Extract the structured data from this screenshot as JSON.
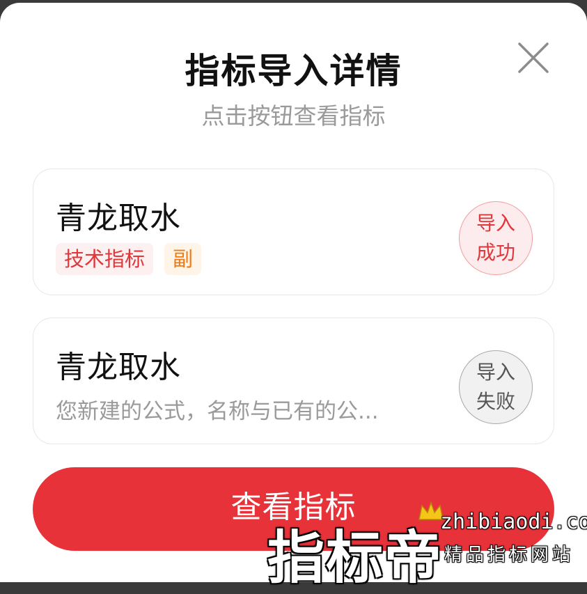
{
  "dialog": {
    "title": "指标导入详情",
    "subtitle": "点击按钮查看指标",
    "close_icon": "close-icon"
  },
  "results": [
    {
      "name": "青龙取水",
      "tags": [
        "技术指标",
        "副"
      ],
      "status_line1": "导入",
      "status_line2": "成功",
      "status": "success"
    },
    {
      "name": "青龙取水",
      "message": "您新建的公式，名称与已有的公...",
      "status_line1": "导入",
      "status_line2": "失败",
      "status": "failed"
    }
  ],
  "primary_button": {
    "label": "查看指标"
  },
  "watermark": {
    "brand": "指标帝",
    "domain": "zhibiaodi.com",
    "slogan": "精品指标网站"
  },
  "colors": {
    "accent": "#e8323a",
    "tag_tech": "#e0373b",
    "tag_sub": "#f07a12",
    "muted": "#9a9a9a"
  }
}
